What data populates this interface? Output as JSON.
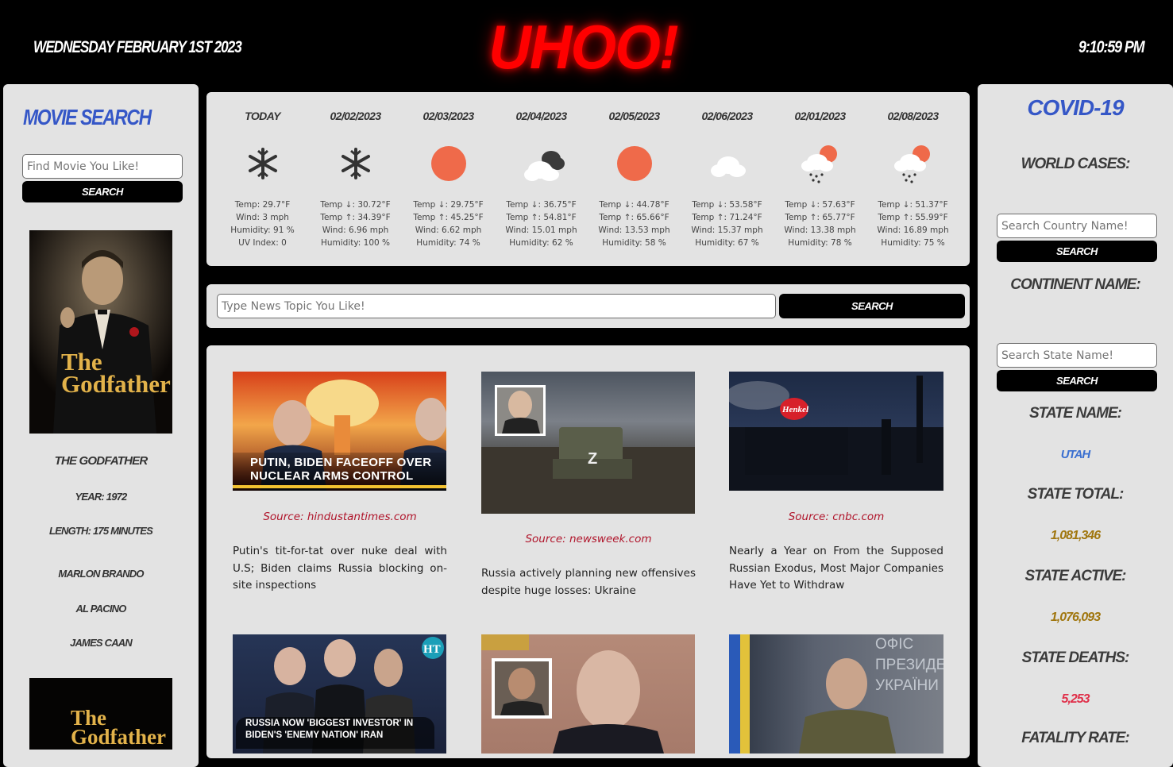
{
  "header": {
    "date": "WEDNESDAY FEBRUARY 1ST 2023",
    "logo": "UHOO!",
    "time": "9:10:59 PM"
  },
  "movie": {
    "title": "MOVIE SEARCH",
    "search_placeholder": "Find Movie You Like!",
    "search_button": "SEARCH",
    "result": {
      "poster_text": "The Godfather",
      "name": "THE GODFATHER",
      "year": "YEAR: 1972",
      "length": "LENGTH: 175 MINUTES",
      "cast": [
        "MARLON BRANDO",
        "AL PACINO",
        "JAMES CAAN"
      ]
    },
    "second_poster_text": "The Godfather"
  },
  "weather": {
    "days": [
      {
        "date": "TODAY",
        "icon": "snow-icon",
        "lines": [
          "Temp: 29.7°F",
          "Wind: 3 mph",
          "Humidity: 91 %",
          "UV Index: 0"
        ]
      },
      {
        "date": "02/02/2023",
        "icon": "snow-icon",
        "lines": [
          "Temp ↓: 30.72°F",
          "Temp ↑: 34.39°F",
          "Wind: 6.96 mph",
          "Humidity: 100 %"
        ]
      },
      {
        "date": "02/03/2023",
        "icon": "sun-icon",
        "lines": [
          "Temp ↓: 29.75°F",
          "Temp ↑: 45.25°F",
          "Wind: 6.62 mph",
          "Humidity: 74 %"
        ]
      },
      {
        "date": "02/04/2023",
        "icon": "dark-clouds-icon",
        "lines": [
          "Temp ↓: 36.75°F",
          "Temp ↑: 54.81°F",
          "Wind: 15.01 mph",
          "Humidity: 62 %"
        ]
      },
      {
        "date": "02/05/2023",
        "icon": "sun-icon",
        "lines": [
          "Temp ↓: 44.78°F",
          "Temp ↑: 65.66°F",
          "Wind: 13.53 mph",
          "Humidity: 58 %"
        ]
      },
      {
        "date": "02/06/2023",
        "icon": "cloud-icon",
        "lines": [
          "Temp ↓: 53.58°F",
          "Temp ↑: 71.24°F",
          "Wind: 15.37 mph",
          "Humidity: 67 %"
        ]
      },
      {
        "date": "02/01/2023",
        "icon": "sun-rain-icon",
        "lines": [
          "Temp ↓: 57.63°F",
          "Temp ↑: 65.77°F",
          "Wind: 13.38 mph",
          "Humidity: 78 %"
        ]
      },
      {
        "date": "02/08/2023",
        "icon": "sun-rain-icon",
        "lines": [
          "Temp ↓: 51.37°F",
          "Temp ↑: 55.99°F",
          "Wind: 16.89 mph",
          "Humidity: 75 %"
        ]
      }
    ]
  },
  "news_search": {
    "placeholder": "Type News Topic You Like!",
    "button": "SEARCH"
  },
  "news": {
    "articles": [
      {
        "image_caption": "PUTIN, BIDEN FACEOFF OVER NUCLEAR ARMS CONTROL",
        "source": "Source: hindustantimes.com",
        "title": "Putin's tit-for-tat over nuke deal with U.S; Biden claims Russia blocking on-site inspections"
      },
      {
        "image_caption": "",
        "source": "Source: newsweek.com",
        "title": "Russia actively planning new offensives despite huge losses: Ukraine"
      },
      {
        "image_caption": "Henkel",
        "source": "Source: cnbc.com",
        "title": "Nearly a Year on From the Supposed Russian Exodus, Most Major Companies Have Yet to Withdraw"
      },
      {
        "image_caption": "RUSSIA NOW 'BIGGEST INVESTOR' IN BIDEN'S 'ENEMY NATION' IRAN",
        "image_badge": "HT",
        "source": "",
        "title": ""
      },
      {
        "image_caption": "",
        "source": "",
        "title": ""
      },
      {
        "image_caption": "ОФІС ПРЕЗИДЕНТА УКРАЇНИ",
        "source": "",
        "title": ""
      }
    ]
  },
  "covid": {
    "title": "COVID-19",
    "world_cases_label": "WORLD CASES:",
    "country_placeholder": "Search Country Name!",
    "country_button": "SEARCH",
    "continent_label": "CONTINENT NAME:",
    "state_placeholder": "Search State Name!",
    "state_button": "SEARCH",
    "state_name_label": "STATE NAME:",
    "state_name_value": "UTAH",
    "state_total_label": "STATE TOTAL:",
    "state_total_value": "1,081,346",
    "state_active_label": "STATE ACTIVE:",
    "state_active_value": "1,076,093",
    "state_deaths_label": "STATE DEATHS:",
    "state_deaths_value": "5,253",
    "fatality_label": "FATALITY RATE:",
    "colors": {
      "total": "#a0760e",
      "active": "#a0760e",
      "deaths": "#e0304a",
      "state": "#3a6fd0"
    }
  }
}
